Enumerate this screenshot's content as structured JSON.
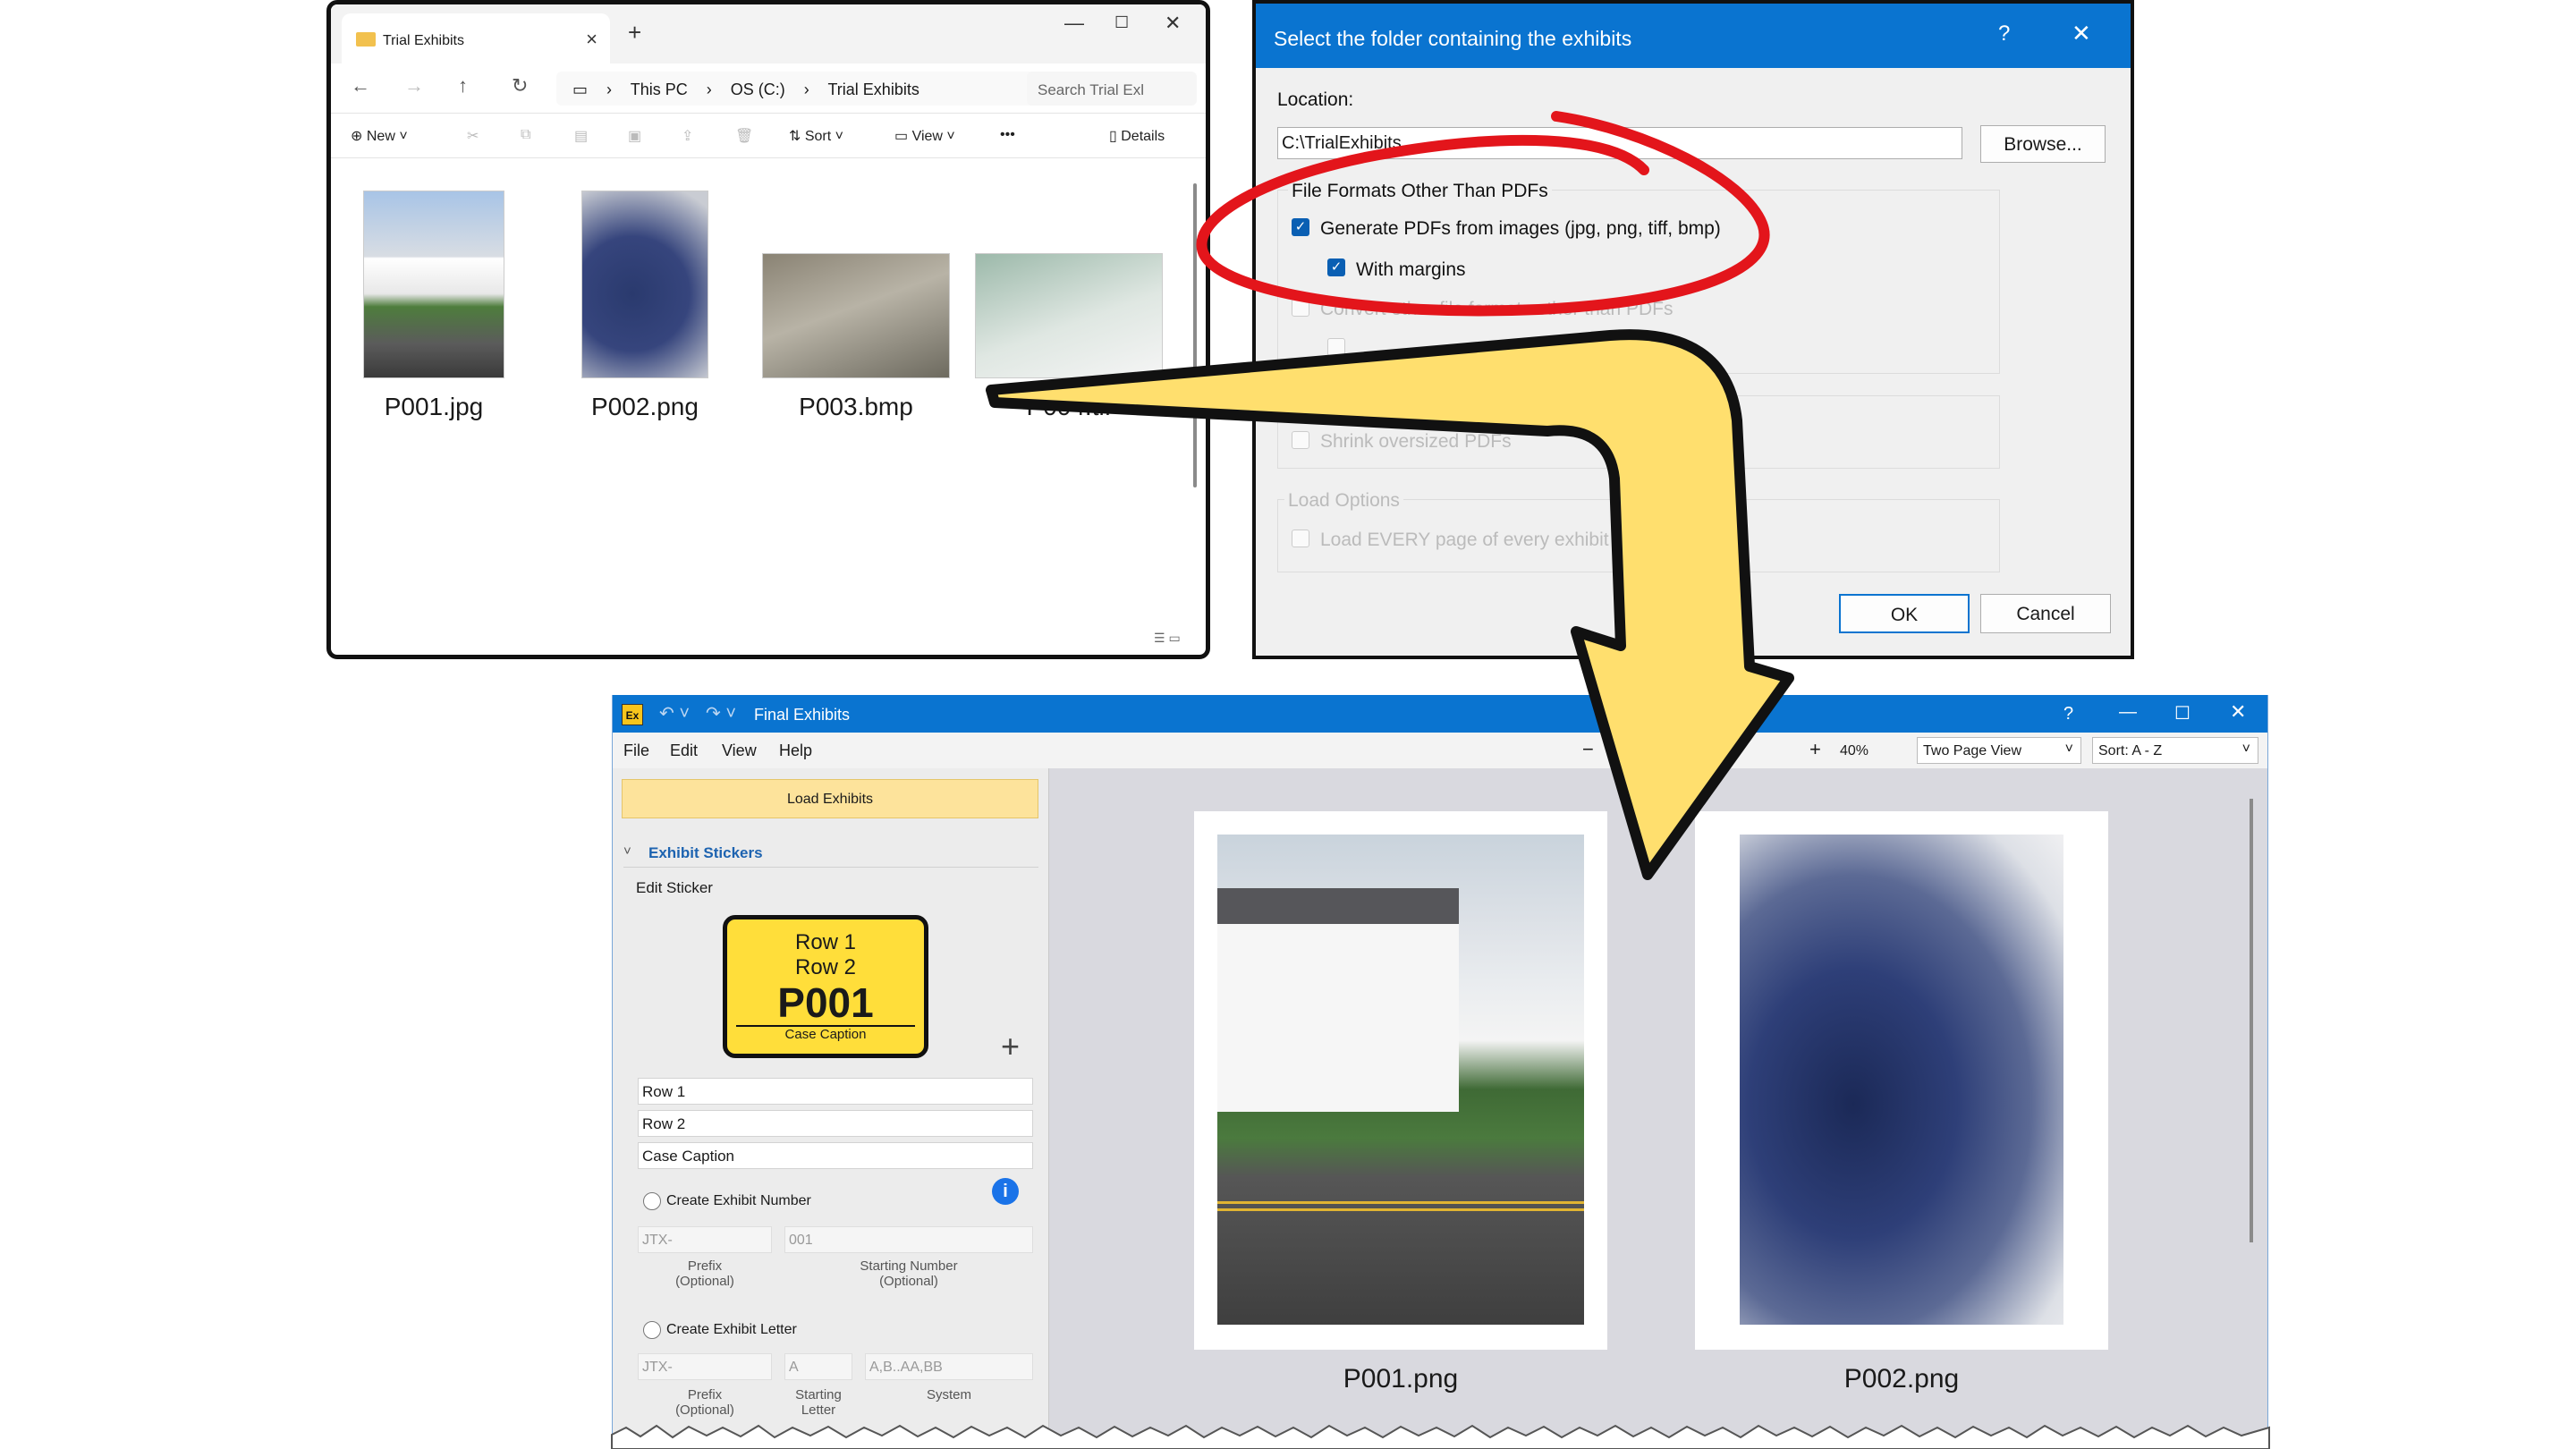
{
  "explorer": {
    "tab_title": "Trial Exhibits",
    "breadcrumbs": [
      "This PC",
      "OS (C:)",
      "Trial Exhibits"
    ],
    "search_placeholder": "Search Trial Exl",
    "commands": {
      "new": "New",
      "sort": "Sort",
      "view": "View",
      "more": "•••",
      "details": "Details"
    },
    "files": [
      "P001.jpg",
      "P002.png",
      "P003.bmp",
      "P004.tif"
    ]
  },
  "dialog": {
    "title": "Select the folder containing the exhibits",
    "help": "?",
    "location_label": "Location:",
    "location_value": "C:\\TrialExhibits",
    "browse_label": "Browse...",
    "formats_group": "File Formats Other Than PDFs",
    "generate_pdfs_label": "Generate PDFs from images (jpg, png, tiff, bmp)",
    "margins_label": "With margins",
    "convert_label": "Convert other file formats other than PDFs",
    "shrink_label": "Shrink oversized PDFs",
    "load_options_group": "Load Options",
    "load_every_label": "Load EVERY page of every exhibit",
    "ok_label": "OK",
    "cancel_label": "Cancel"
  },
  "app": {
    "logo": "Ex",
    "title": "Final Exhibits",
    "help": "?",
    "menu": [
      "File",
      "Edit",
      "View",
      "Help"
    ],
    "zoom_minus": "−",
    "zoom_plus": "+",
    "zoom_level": "40%",
    "view_mode": "Two Page View",
    "sort": "Sort: A - Z",
    "load_button": "Load Exhibits",
    "section_title": "Exhibit Stickers",
    "edit_sticker": "Edit Sticker",
    "sticker": {
      "row1": "Row 1",
      "row2": "Row 2",
      "number": "P001",
      "caption": "Case Caption"
    },
    "fields": {
      "row1": "Row 1",
      "row2": "Row 2",
      "caption": "Case Caption"
    },
    "create_number_label": "Create Exhibit Number",
    "number_prefix_placeholder": "JTX-",
    "number_start_placeholder": "001",
    "prefix_hint": "Prefix\n(Optional)",
    "starting_number_hint": "Starting Number\n(Optional)",
    "create_letter_label": "Create Exhibit Letter",
    "letter_prefix_placeholder": "JTX-",
    "letter_start_placeholder": "A",
    "letter_system": "A,B..AA,BB",
    "letter_prefix_hint": "Prefix\n(Optional)",
    "starting_letter_hint": "Starting\nLetter",
    "system_hint": "System",
    "pages": [
      "P001.png",
      "P002.png"
    ]
  },
  "colors": {
    "title_blue": "#0a74d0",
    "sticker_yellow": "#ffde3a",
    "annotation_red": "#e3151b",
    "arrow_yellow": "#ffdf6e"
  }
}
